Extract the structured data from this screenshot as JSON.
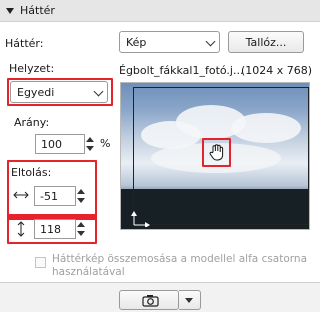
{
  "panel": {
    "title": "Háttér"
  },
  "background": {
    "label": "Háttér:",
    "selected": "Kép",
    "browse_label": "Tallóz..."
  },
  "position": {
    "label": "Helyzet:",
    "selected": "Egyedi"
  },
  "image": {
    "filename": "Égbolt_fákkal1_fotó.j...",
    "dimensions": "(1024 x 768)"
  },
  "ratio": {
    "label": "Arány:",
    "value": "100",
    "unit": "%"
  },
  "offset": {
    "label": "Eltolás:",
    "x_value": "-51",
    "y_value": "118"
  },
  "alpha_blend": {
    "label_line1": "Háttérkép összemosása a modellel alfa csatorna",
    "label_line2": "használatával",
    "checked": false
  },
  "colors": {
    "highlight": "#e8222a"
  }
}
